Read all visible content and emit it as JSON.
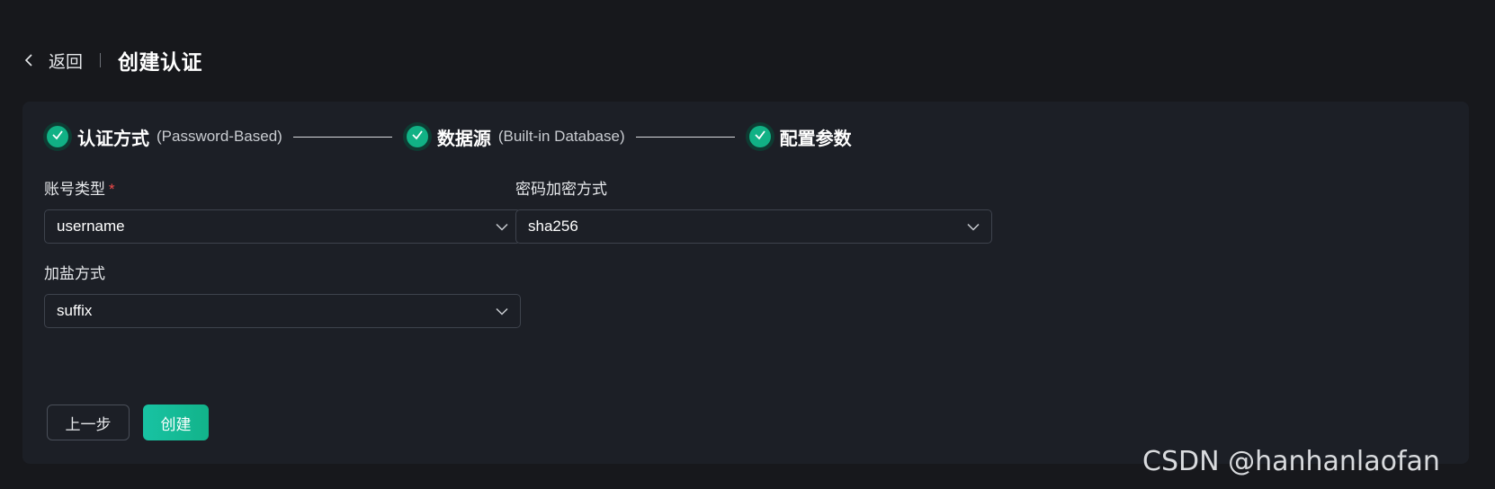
{
  "header": {
    "back_label": "返回",
    "title": "创建认证"
  },
  "steps": [
    {
      "title": "认证方式",
      "subtitle": "(Password-Based)",
      "status": "done"
    },
    {
      "title": "数据源",
      "subtitle": "(Built-in Database)",
      "status": "done"
    },
    {
      "title": "配置参数",
      "subtitle": "",
      "status": "done"
    }
  ],
  "form": {
    "account_type": {
      "label": "账号类型",
      "required_mark": "*",
      "value": "username"
    },
    "password_hash": {
      "label": "密码加密方式",
      "value": "sha256"
    },
    "salt_position": {
      "label": "加盐方式",
      "value": "suffix"
    }
  },
  "actions": {
    "prev_label": "上一步",
    "create_label": "创建"
  },
  "watermark": "CSDN @hanhanlaofan",
  "colors": {
    "background": "#17181c",
    "panel": "#1c1f26",
    "accent": "#12b38a",
    "required": "#f04a4a"
  },
  "icons": {
    "back": "chevron-left-icon",
    "step_done": "check-icon",
    "select": "chevron-down-icon"
  }
}
